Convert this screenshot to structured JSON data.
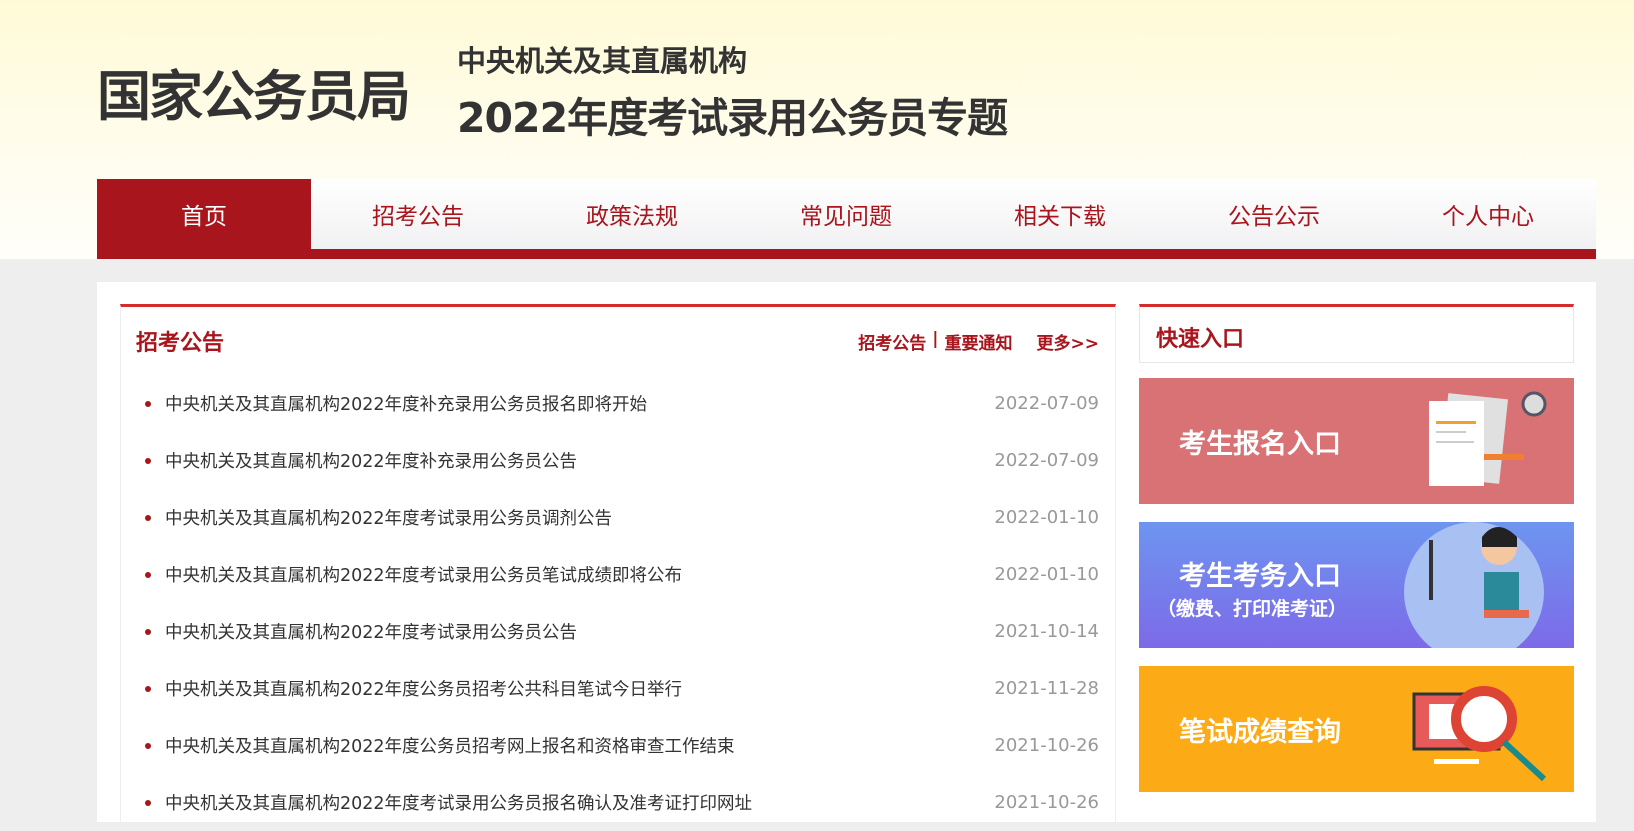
{
  "header": {
    "logo": "国家公务员局",
    "subtitle": "中央机关及其直属机构",
    "title": "2022年度考试录用公务员专题"
  },
  "nav": [
    "首页",
    "招考公告",
    "政策法规",
    "常见问题",
    "相关下载",
    "公告公示",
    "个人中心"
  ],
  "notices": {
    "title": "招考公告",
    "links": [
      "招考公告",
      "|",
      "重要通知"
    ],
    "more": "更多>>",
    "items": [
      {
        "title": "中央机关及其直属机构2022年度补充录用公务员报名即将开始",
        "date": "2022-07-09"
      },
      {
        "title": "中央机关及其直属机构2022年度补充录用公务员公告",
        "date": "2022-07-09"
      },
      {
        "title": "中央机关及其直属机构2022年度考试录用公务员调剂公告",
        "date": "2022-01-10"
      },
      {
        "title": "中央机关及其直属机构2022年度考试录用公务员笔试成绩即将公布",
        "date": "2022-01-10"
      },
      {
        "title": "中央机关及其直属机构2022年度考试录用公务员公告",
        "date": "2021-10-14"
      },
      {
        "title": "中央机关及其直属机构2022年度公务员招考公共科目笔试今日举行",
        "date": "2021-11-28"
      },
      {
        "title": "中央机关及其直属机构2022年度公务员招考网上报名和资格审查工作结束",
        "date": "2021-10-26"
      },
      {
        "title": "中央机关及其直属机构2022年度考试录用公务员报名确认及准考证打印网址",
        "date": "2021-10-26"
      }
    ]
  },
  "quick": {
    "title": "快速入口",
    "banners": [
      {
        "label": "考生报名入口",
        "sub": ""
      },
      {
        "label": "考生考务入口",
        "sub": "（缴费、打印准考证）"
      },
      {
        "label": "笔试成绩查询",
        "sub": ""
      }
    ]
  },
  "colors": {
    "primary": "#a8151c",
    "accent": "#d52b2b",
    "banner1": "#d87274",
    "banner2": "#7d6ae8",
    "banner3": "#fcab17"
  }
}
